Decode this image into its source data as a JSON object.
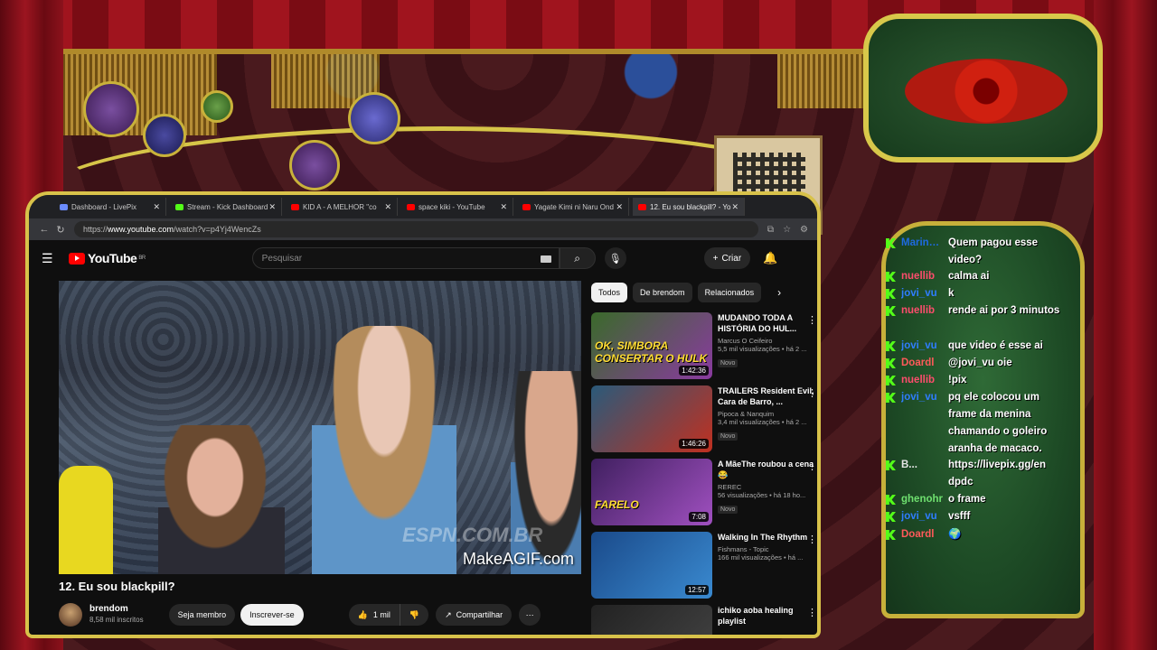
{
  "browser": {
    "tabs": [
      {
        "label": "Dashboard - LivePix",
        "color": "#6b8cff"
      },
      {
        "label": "Stream - Kick Dashboard",
        "color": "#53fc18"
      },
      {
        "label": "KID A - A MELHOR \"co",
        "color": "#ff0000"
      },
      {
        "label": "space kiki - YouTube",
        "color": "#ff0000"
      },
      {
        "label": "Yagate Kimi ni Naru Ond",
        "color": "#ff0000"
      },
      {
        "label": "12. Eu sou blackpill? - Yo",
        "color": "#ff0000"
      }
    ],
    "url_prefix": "https://",
    "url_host": "www.youtube.com",
    "url_path": "/watch?v=p4Yj4WencZs"
  },
  "youtube": {
    "logo": "YouTube",
    "region": "BR",
    "search_placeholder": "Pesquisar",
    "create_label": "Criar",
    "video": {
      "title": "12. Eu sou blackpill?",
      "watermark": "MakeAGIF.com",
      "espn": "ESPN.COM.BR",
      "channel": "brendom",
      "subscribers": "8,58 mil inscritos",
      "member_label": "Seja membro",
      "subscribe_label": "Inscrever-se",
      "likes": "1 mil",
      "share_label": "Compartilhar"
    },
    "chips": [
      "Todos",
      "De brendom",
      "Relacionados"
    ],
    "recommendations": [
      {
        "title": "MUDANDO TODA A HISTÓRIA DO HUL...",
        "channel": "Marcus O Ceifeiro",
        "views": "5,5 mil visualizações • há 2 ...",
        "badge": "Novo",
        "duration": "1:42:36",
        "thumb_text": "OK, SIMBORA CONSERTAR O HULK",
        "colors": [
          "#3a6a2a",
          "#8a3aa0"
        ]
      },
      {
        "title": "TRAILERS Resident Evil, Cara de Barro, ...",
        "channel": "Pipoca & Nanquim",
        "views": "3,4 mil visualizações • há 2 ...",
        "badge": "Novo",
        "duration": "1:46:26",
        "thumb_text": "",
        "colors": [
          "#2a5a7a",
          "#c03020"
        ]
      },
      {
        "title": "A MãeThe roubou a cena 😂",
        "channel": "REREC",
        "views": "56 visualizações • há 18 ho...",
        "badge": "Novo",
        "duration": "7:08",
        "thumb_text": "FARELO",
        "colors": [
          "#402060",
          "#a050c0"
        ]
      },
      {
        "title": "Walking In The Rhythm",
        "channel": "Fishmans - Topic",
        "views": "166 mil visualizações • há ...",
        "badge": "",
        "duration": "12:57",
        "thumb_text": "",
        "colors": [
          "#1a4a8a",
          "#3a8ad0"
        ]
      },
      {
        "title": "ichiko aoba healing playlist",
        "channel": "",
        "views": "",
        "badge": "",
        "duration": "",
        "thumb_text": "",
        "colors": [
          "#222222",
          "#444444"
        ]
      }
    ]
  },
  "chat": {
    "messages": [
      {
        "user": "Marinh...",
        "text": "Quem pagou esse video?"
      },
      {
        "user": "nuellib",
        "text": "calma ai"
      },
      {
        "user": "jovi_vu",
        "text": "k"
      },
      {
        "user": "nuellib",
        "text": "rende ai por 3 minutos"
      },
      {
        "user": "jovi_vu",
        "text": "que video é esse ai"
      },
      {
        "user": "Doardl",
        "text": "@jovi_vu oie"
      },
      {
        "user": "nuellib",
        "text": "!pix"
      },
      {
        "user": "jovi_vu",
        "text": "pq ele colocou um frame da menina chamando o goleiro aranha de macaco."
      },
      {
        "user": "B...",
        "text": "https://livepix.gg/en dpdc"
      },
      {
        "user": "ghenohr",
        "text": "o frame"
      },
      {
        "user": "jovi_vu",
        "text": "vsfff"
      },
      {
        "user": "Doardl",
        "text": "🌍"
      }
    ],
    "user_colors": {
      "Marinh...": "#1e6ae0",
      "nuellib": "#ff4d6d",
      "jovi_vu": "#2f7dff",
      "Doardl": "#ff5a5a",
      "B...": "#e6e6e6",
      "ghenohr": "#6fe06f"
    },
    "kick_color": "#53fc18"
  }
}
